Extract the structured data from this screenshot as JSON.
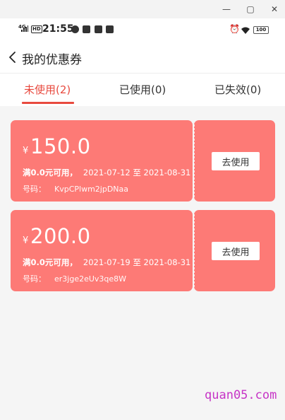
{
  "window": {
    "minimize_glyph": "—",
    "maximize_glyph": "▢",
    "close_glyph": "✕"
  },
  "status_bar": {
    "network": "4G",
    "hd": "HD",
    "time": "21:55",
    "battery": "100",
    "icons": [
      "signal-icon",
      "hd-icon",
      "notification-icon",
      "message-icon",
      "app-icon",
      "alarm-icon",
      "wifi-icon",
      "battery-icon"
    ]
  },
  "header": {
    "back_icon": "chevron-left-icon",
    "title": "我的优惠券"
  },
  "tabs": [
    {
      "label": "未使用(2)",
      "active": true
    },
    {
      "label": "已使用(0)",
      "active": false
    },
    {
      "label": "已失效(0)",
      "active": false
    }
  ],
  "coupons": [
    {
      "currency": "¥",
      "amount": "150.0",
      "condition": "满0.0元可用，",
      "dates": "2021-07-12 至 2021-08-31",
      "code_label": "号码：",
      "code": "KvpCPlwm2jpDNaa",
      "button": "去使用"
    },
    {
      "currency": "¥",
      "amount": "200.0",
      "condition": "满0.0元可用，",
      "dates": "2021-07-19 至 2021-08-31",
      "code_label": "号码：",
      "code": "er3jge2eUv3qe8W",
      "button": "去使用"
    }
  ],
  "watermark": "quan05.com",
  "colors": {
    "accent": "#e84a3f",
    "coupon_bg": "#fd7a76",
    "content_bg": "#f5f5f5",
    "watermark": "#c634c6"
  }
}
